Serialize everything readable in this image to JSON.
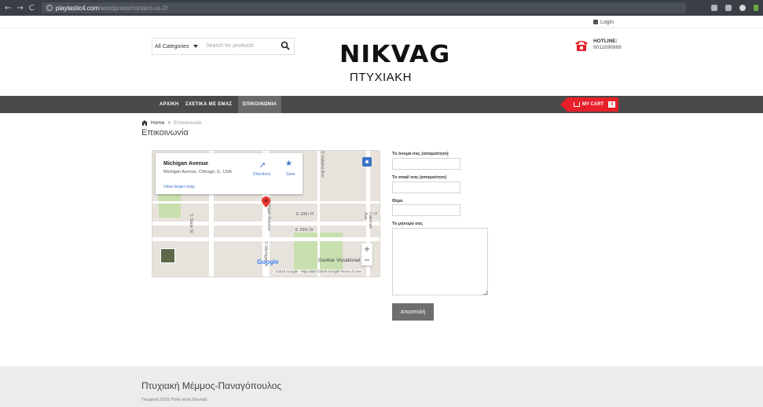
{
  "browser": {
    "back": "←",
    "forward": "→",
    "reload": "C",
    "url_domain": "playtastic4.com",
    "url_path": "/wordpress/contact-us-2/"
  },
  "topbar": {
    "login": "Login"
  },
  "header": {
    "category_select": "All Categories",
    "search_placeholder": "Search for products",
    "logo_title": "NIKVAG",
    "logo_subtitle": "ΠΤΥΧΙΑΚΗ",
    "hotline_label": "HOTLINE:",
    "hotline_number": "9011696969"
  },
  "nav": {
    "items": [
      {
        "label": "ΑΡΧΙΚΗ"
      },
      {
        "label": "ΣΧΕΤΙΚΑ ΜΕ ΕΜΑΣ"
      },
      {
        "label": "ΕΠΙΚΟΙΝΩΝΙΑ"
      }
    ],
    "cart_label": "MY CART",
    "cart_count": "0"
  },
  "breadcrumb": {
    "home": "Home",
    "separator": ">",
    "current": "Επικοινωνία"
  },
  "page": {
    "title": "Επικοινωνία"
  },
  "map": {
    "place_name": "Michigan Avenue",
    "place_address": "Michigan Avenue, Chicago, IL, USA",
    "larger_map": "View larger map",
    "directions": "Directions",
    "save": "Save",
    "streets": {
      "e28": "E 28th Pl",
      "e29": "E 29th St",
      "state": "S State St",
      "michigan": "Michigan Avenue",
      "smichigan": "S Michigan A",
      "indiana": "S Indiana Ave",
      "calumet": "S Calumet Ave"
    },
    "poi": "Dunbar Vocational",
    "google": "Google",
    "attribution": "©2016 Google · Map data ©2016 Google   Terms of Use"
  },
  "form": {
    "name_label": "Το όνομά σας (απαραίτητο)",
    "email_label": "Το email σας (απαραίτητο)",
    "subject_label": "Θέμα",
    "message_label": "Το μήνυμά σας",
    "submit": "Αποστολή"
  },
  "footer": {
    "title": "Πτυχιακή Μέμμος-Παναγόπουλος",
    "copyright": "Πτυχιακή 2016 Πολύ καλή δουλειά"
  },
  "colors": {
    "nav_bg": "#4a4a4a",
    "cart_red": "#e8202a",
    "footer_bg": "#ececec"
  }
}
